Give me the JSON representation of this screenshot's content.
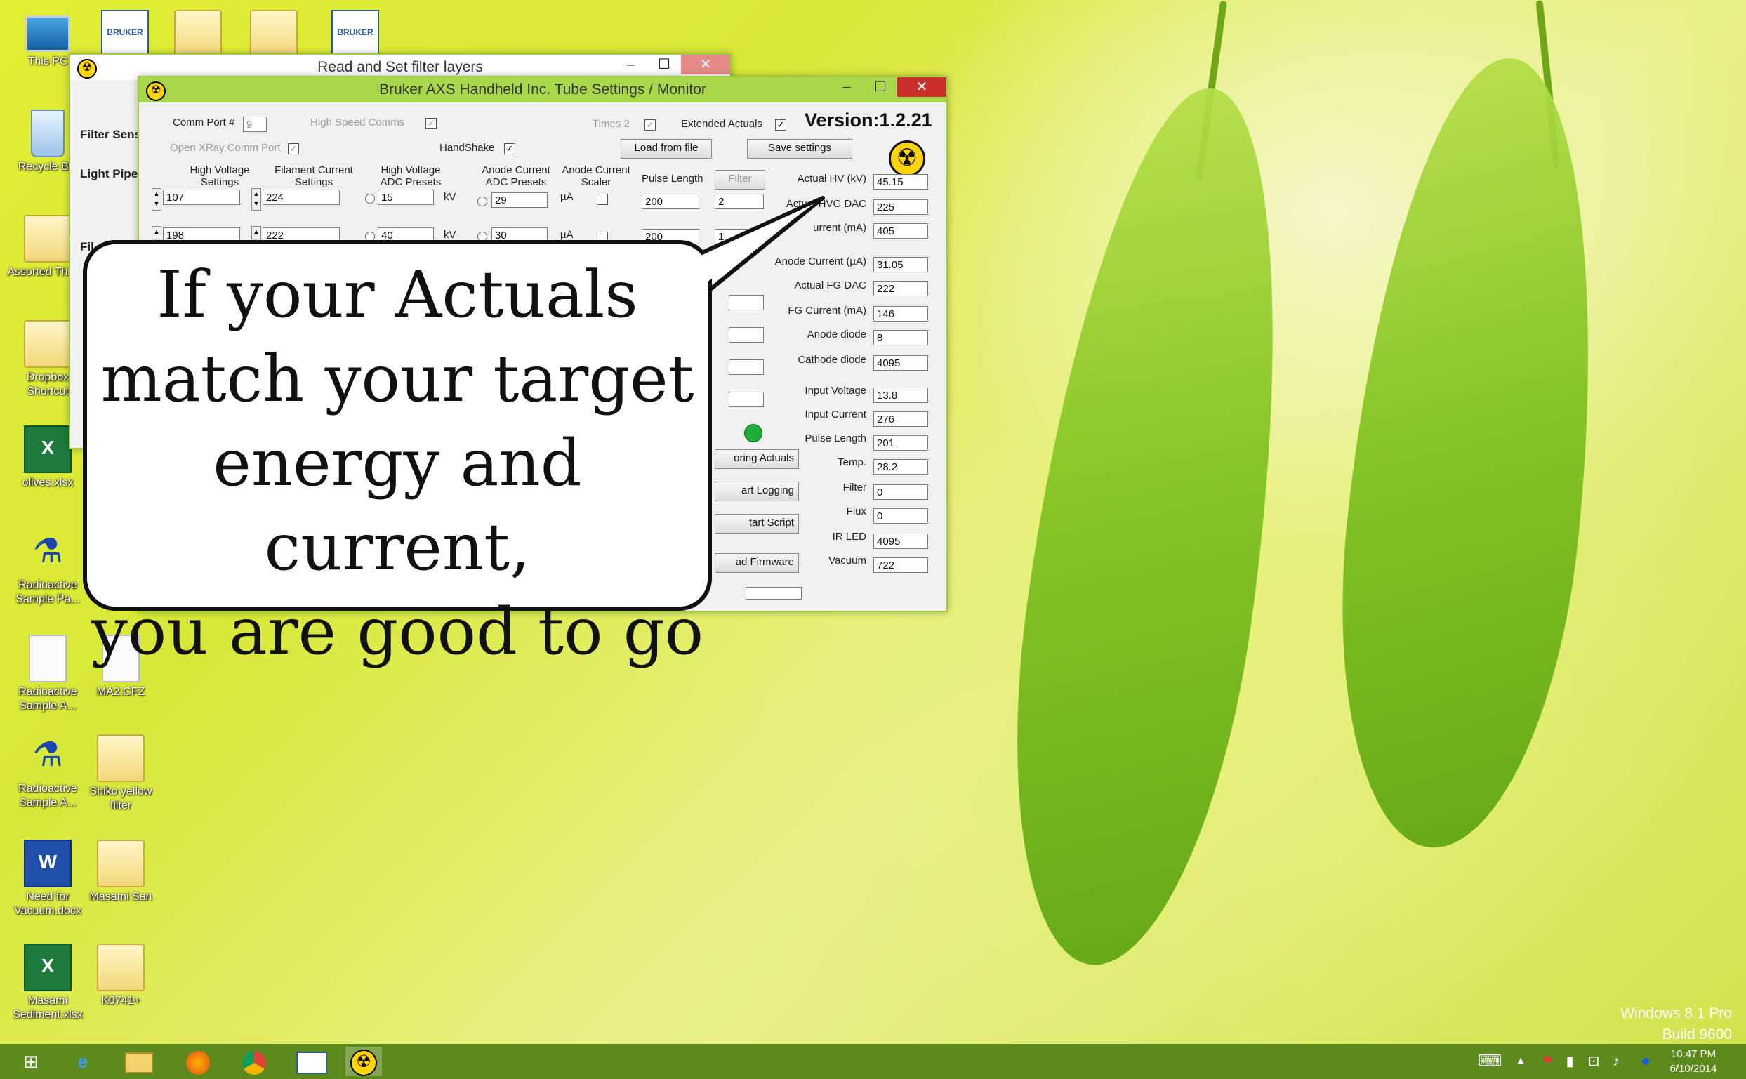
{
  "desktop_icons": [
    {
      "label": "This PC",
      "kind": "pc",
      "icon": "computer-icon"
    },
    {
      "label": "",
      "kind": "bruker",
      "icon": "bruker-logo-icon",
      "logo_text": "BRUKER"
    },
    {
      "label": "",
      "kind": "folder",
      "icon": "folder-icon"
    },
    {
      "label": "",
      "kind": "folder",
      "icon": "folder-icon"
    },
    {
      "label": "",
      "kind": "bruker",
      "icon": "bruker-logo-icon",
      "logo_text": "BRUKER"
    },
    {
      "label": "Recycle Bin",
      "kind": "bin",
      "icon": "recycle-bin-icon"
    },
    {
      "label": "Assorted Things",
      "kind": "folder",
      "icon": "folder-icon"
    },
    {
      "label": "Dropbox Shortcut",
      "kind": "folder",
      "icon": "folder-shortcut-icon"
    },
    {
      "label": "olives.xlsx",
      "kind": "xls",
      "icon": "excel-file-icon"
    },
    {
      "label": "Radioactive Sample Pa...",
      "kind": "rad",
      "icon": "radioactive-sample-icon"
    },
    {
      "label": "Radioactive Sample A...",
      "kind": "doc",
      "icon": "document-icon"
    },
    {
      "label": "MA2.CFZ",
      "kind": "doc",
      "icon": "document-icon"
    },
    {
      "label": "Radioactive Sample A...",
      "kind": "rad",
      "icon": "radioactive-sample-icon"
    },
    {
      "label": "Shiko yellow filter",
      "kind": "folder",
      "icon": "folder-icon"
    },
    {
      "label": "Need for Vacuum.docx",
      "kind": "wrd",
      "icon": "word-file-icon"
    },
    {
      "label": "Masami San",
      "kind": "folder",
      "icon": "folder-icon"
    },
    {
      "label": "Masami Sediment.xlsx",
      "kind": "xls",
      "icon": "excel-file-icon"
    },
    {
      "label": "K0741+",
      "kind": "folder",
      "icon": "folder-icon"
    }
  ],
  "back_window": {
    "title": "Read and Set filter layers",
    "rows": [
      "Filter Sens",
      "Light Pipe",
      "Fil"
    ],
    "minimize": "–",
    "maximize": "☐",
    "close": "✕"
  },
  "main_window": {
    "title": "Bruker AXS Handheld Inc. Tube Settings / Monitor",
    "minimize": "–",
    "maximize": "☐",
    "close": "✕",
    "comm_port_label": "Comm Port #",
    "comm_port_value": "9",
    "high_speed_label": "High Speed Comms",
    "times2_label": "Times 2",
    "extended_actuals_label": "Extended Actuals",
    "version": "Version:1.2.21",
    "openxray_label": "Open XRay Comm Port",
    "handshake_label": "HandShake",
    "load_button": "Load from file",
    "save_button": "Save settings",
    "col_hv": [
      "High Voltage",
      "Settings"
    ],
    "col_fc": [
      "Filament Current",
      "Settings"
    ],
    "col_hvadc": [
      "High Voltage",
      "ADC Presets"
    ],
    "col_anode": [
      "Anode Current",
      "ADC Presets"
    ],
    "col_scaler": [
      "Anode Current",
      "Scaler"
    ],
    "col_pulse": "Pulse Length",
    "filter_button": "Filter",
    "row1": {
      "hv": "107",
      "fc": "224",
      "hvadc": "15",
      "kv": "kV",
      "anode": "29",
      "ua": "µA",
      "pulse": "200",
      "filter": "2"
    },
    "row2": {
      "hv": "198",
      "fc": "222",
      "hvadc": "40",
      "kv": "kV",
      "anode": "30",
      "ua": "µA",
      "pulse": "200",
      "filter": "1"
    },
    "actuals": [
      {
        "label": "Actual HV (kV)",
        "value": "45.15"
      },
      {
        "label": "Actual HVG DAC",
        "value": "225"
      },
      {
        "label": "urrent (mA)",
        "value": "405"
      },
      {
        "label": "Anode Current (µA)",
        "value": "31.05"
      },
      {
        "label": "Actual FG DAC",
        "value": "222"
      },
      {
        "label": "FG Current (mA)",
        "value": "146"
      },
      {
        "label": "Anode diode",
        "value": "8"
      },
      {
        "label": "Cathode diode",
        "value": "4095"
      },
      {
        "label": "Input Voltage",
        "value": "13.8"
      },
      {
        "label": "Input Current",
        "value": "276"
      },
      {
        "label": "Pulse Length",
        "value": "201"
      },
      {
        "label": "Temp.",
        "value": "28.2"
      },
      {
        "label": "Filter",
        "value": "0"
      },
      {
        "label": "Flux",
        "value": "0"
      },
      {
        "label": "IR LED",
        "value": "4095"
      },
      {
        "label": "Vacuum",
        "value": "722"
      }
    ],
    "side_buttons": [
      "oring Actuals",
      "art Logging",
      "tart Script",
      "ad Firmware"
    ],
    "status_color": "#1fae3a"
  },
  "callout": {
    "lines": [
      "If your Actuals",
      "match your target",
      "energy and current,",
      "you are good to go"
    ]
  },
  "watermark": {
    "line1": "Windows 8.1 Pro",
    "line2": "Build 9600"
  },
  "taskbar": {
    "items": [
      "windows-start-icon",
      "internet-explorer-icon",
      "file-explorer-icon",
      "firefox-icon",
      "chrome-icon",
      "bruker-app-icon",
      "radiation-app-icon"
    ],
    "time": "10:47 PM",
    "date": "6/10/2014",
    "tray": [
      "keyboard-icon",
      "chevron-up-icon",
      "flag-icon",
      "battery-icon",
      "network-icon",
      "volume-icon",
      "dropbox-icon"
    ]
  }
}
